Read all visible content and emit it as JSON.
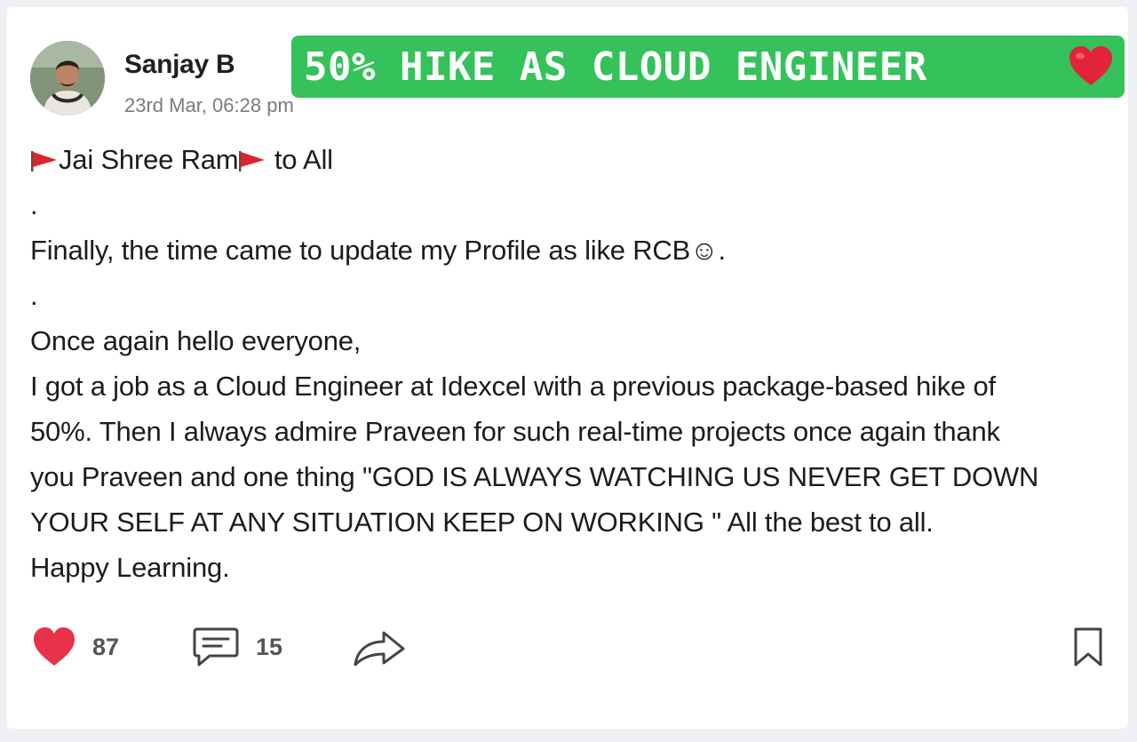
{
  "post": {
    "author_name": "Sanjay B",
    "timestamp": "23rd Mar, 06:28 pm",
    "banner_text": "50% HIKE AS CLOUD ENGINEER",
    "body": {
      "line1_text": "Jai Shree Ram",
      "line1_suffix": " to All",
      "line2": ".",
      "line3": "Finally, the time came to update my Profile as like RCB☺.",
      "line4": ".",
      "line5": "Once again hello everyone,",
      "line6": "I got a job as a Cloud Engineer at Idexcel with a previous package-based hike of",
      "line7": "50%. Then I always admire Praveen for such real-time projects once again thank",
      "line8": "you Praveen and one thing \"GOD IS ALWAYS WATCHING US NEVER GET DOWN",
      "line9": "YOUR SELF AT ANY SITUATION KEEP ON WORKING \" All the best to all.",
      "line10": "Happy Learning."
    }
  },
  "actions": {
    "like_count": "87",
    "comment_count": "15"
  },
  "icons": {
    "like": "heart-icon",
    "comment": "comment-icon",
    "share": "share-icon",
    "bookmark": "bookmark-icon",
    "flag": "red-flag-icon"
  },
  "colors": {
    "banner": "#35c25a",
    "like": "#e8324a",
    "text": "#1c1c1c",
    "muted": "#7b7b7b"
  }
}
